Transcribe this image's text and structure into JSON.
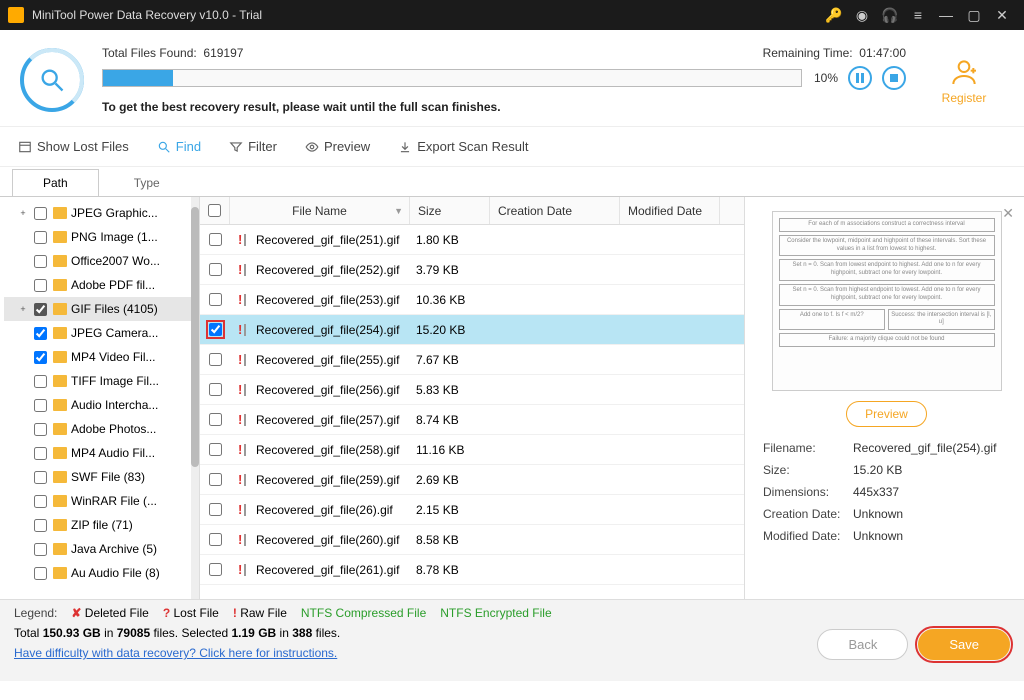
{
  "title": "MiniTool Power Data Recovery v10.0 - Trial",
  "scan": {
    "found_label": "Total Files Found:",
    "found_count": "619197",
    "remaining_label": "Remaining Time:",
    "remaining_value": "01:47:00",
    "percent": "10%",
    "message": "To get the best recovery result, please wait until the full scan finishes."
  },
  "register": "Register",
  "toolbar": {
    "show_lost": "Show Lost Files",
    "find": "Find",
    "filter": "Filter",
    "preview": "Preview",
    "export": "Export Scan Result"
  },
  "tabs": {
    "path": "Path",
    "type": "Type"
  },
  "tree": [
    {
      "exp": "+",
      "chk": false,
      "label": "JPEG Graphic..."
    },
    {
      "exp": "",
      "chk": false,
      "label": "PNG Image (1..."
    },
    {
      "exp": "",
      "chk": false,
      "label": "Office2007 Wo..."
    },
    {
      "exp": "",
      "chk": false,
      "label": "Adobe PDF fil..."
    },
    {
      "exp": "+",
      "chk": true,
      "label": "GIF Files (4105)",
      "sel": true,
      "chkfill": true
    },
    {
      "exp": "",
      "chk": true,
      "label": "JPEG Camera..."
    },
    {
      "exp": "",
      "chk": true,
      "label": "MP4 Video Fil..."
    },
    {
      "exp": "",
      "chk": false,
      "label": "TIFF Image Fil..."
    },
    {
      "exp": "",
      "chk": false,
      "label": "Audio Intercha..."
    },
    {
      "exp": "",
      "chk": false,
      "label": "Adobe Photos..."
    },
    {
      "exp": "",
      "chk": false,
      "label": "MP4 Audio Fil..."
    },
    {
      "exp": "",
      "chk": false,
      "label": "SWF File (83)"
    },
    {
      "exp": "",
      "chk": false,
      "label": "WinRAR File (..."
    },
    {
      "exp": "",
      "chk": false,
      "label": "ZIP file (71)"
    },
    {
      "exp": "",
      "chk": false,
      "label": "Java Archive (5)"
    },
    {
      "exp": "",
      "chk": false,
      "label": "Au Audio File (8)"
    }
  ],
  "columns": {
    "name": "File Name",
    "size": "Size",
    "cdate": "Creation Date",
    "mdate": "Modified Date"
  },
  "files": [
    {
      "name": "Recovered_gif_file(251).gif",
      "size": "1.80 KB"
    },
    {
      "name": "Recovered_gif_file(252).gif",
      "size": "3.79 KB"
    },
    {
      "name": "Recovered_gif_file(253).gif",
      "size": "10.36 KB"
    },
    {
      "name": "Recovered_gif_file(254).gif",
      "size": "15.20 KB",
      "sel": true,
      "chk": true,
      "hl": true
    },
    {
      "name": "Recovered_gif_file(255).gif",
      "size": "7.67 KB"
    },
    {
      "name": "Recovered_gif_file(256).gif",
      "size": "5.83 KB"
    },
    {
      "name": "Recovered_gif_file(257).gif",
      "size": "8.74 KB"
    },
    {
      "name": "Recovered_gif_file(258).gif",
      "size": "11.16 KB"
    },
    {
      "name": "Recovered_gif_file(259).gif",
      "size": "2.69 KB"
    },
    {
      "name": "Recovered_gif_file(26).gif",
      "size": "2.15 KB"
    },
    {
      "name": "Recovered_gif_file(260).gif",
      "size": "8.58 KB"
    },
    {
      "name": "Recovered_gif_file(261).gif",
      "size": "8.78 KB"
    }
  ],
  "preview": {
    "button": "Preview",
    "filename_k": "Filename:",
    "filename_v": "Recovered_gif_file(254).gif",
    "size_k": "Size:",
    "size_v": "15.20 KB",
    "dim_k": "Dimensions:",
    "dim_v": "445x337",
    "cdate_k": "Creation Date:",
    "cdate_v": "Unknown",
    "mdate_k": "Modified Date:",
    "mdate_v": "Unknown"
  },
  "legend": {
    "label": "Legend:",
    "deleted": "Deleted File",
    "lost": "Lost File",
    "raw": "Raw File",
    "ntfs_c": "NTFS Compressed File",
    "ntfs_e": "NTFS Encrypted File"
  },
  "stats": {
    "p1": "Total ",
    "total_gb": "150.93 GB",
    "p2": " in ",
    "total_files": "79085",
    "p3": " files.  Selected ",
    "sel_gb": "1.19 GB",
    "p4": " in ",
    "sel_files": "388",
    "p5": " files."
  },
  "help": "Have difficulty with data recovery? Click here for instructions.",
  "buttons": {
    "back": "Back",
    "save": "Save"
  }
}
